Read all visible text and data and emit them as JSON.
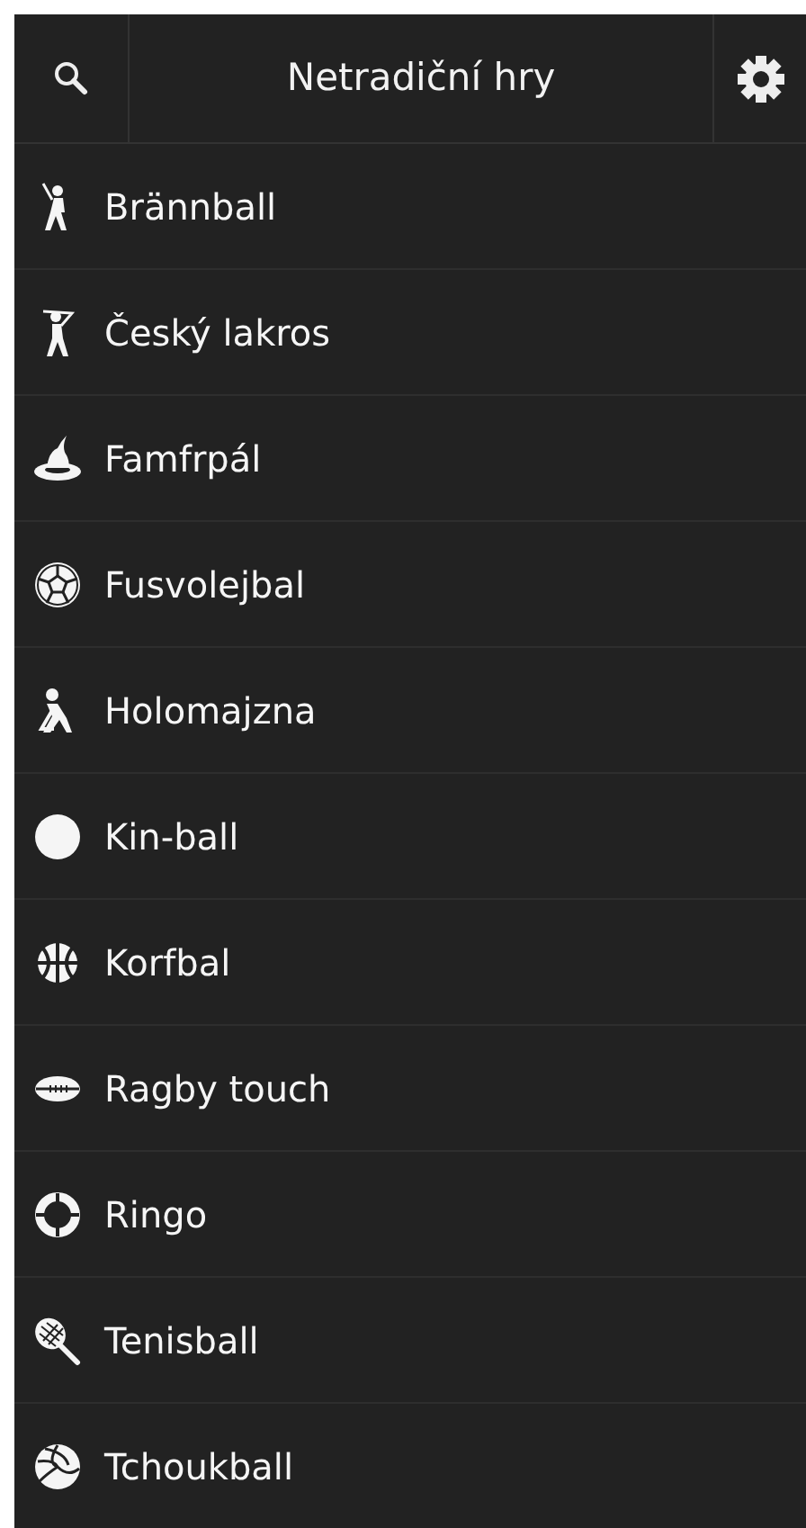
{
  "header": {
    "title": "Netradiční hry"
  },
  "items": [
    {
      "label": "Brännball",
      "kind": "batter"
    },
    {
      "label": "Český lakros",
      "kind": "golfer"
    },
    {
      "label": "Famfrpál",
      "kind": "hat"
    },
    {
      "label": "Fusvolejbal",
      "kind": "football"
    },
    {
      "label": "Holomajzna",
      "kind": "hockey"
    },
    {
      "label": "Kin-ball",
      "kind": "disc"
    },
    {
      "label": "Korfbal",
      "kind": "basketball"
    },
    {
      "label": "Ragby touch",
      "kind": "rugby"
    },
    {
      "label": "Ringo",
      "kind": "ring"
    },
    {
      "label": "Tenisball",
      "kind": "racket"
    },
    {
      "label": "Tchoukball",
      "kind": "volleyball"
    }
  ]
}
